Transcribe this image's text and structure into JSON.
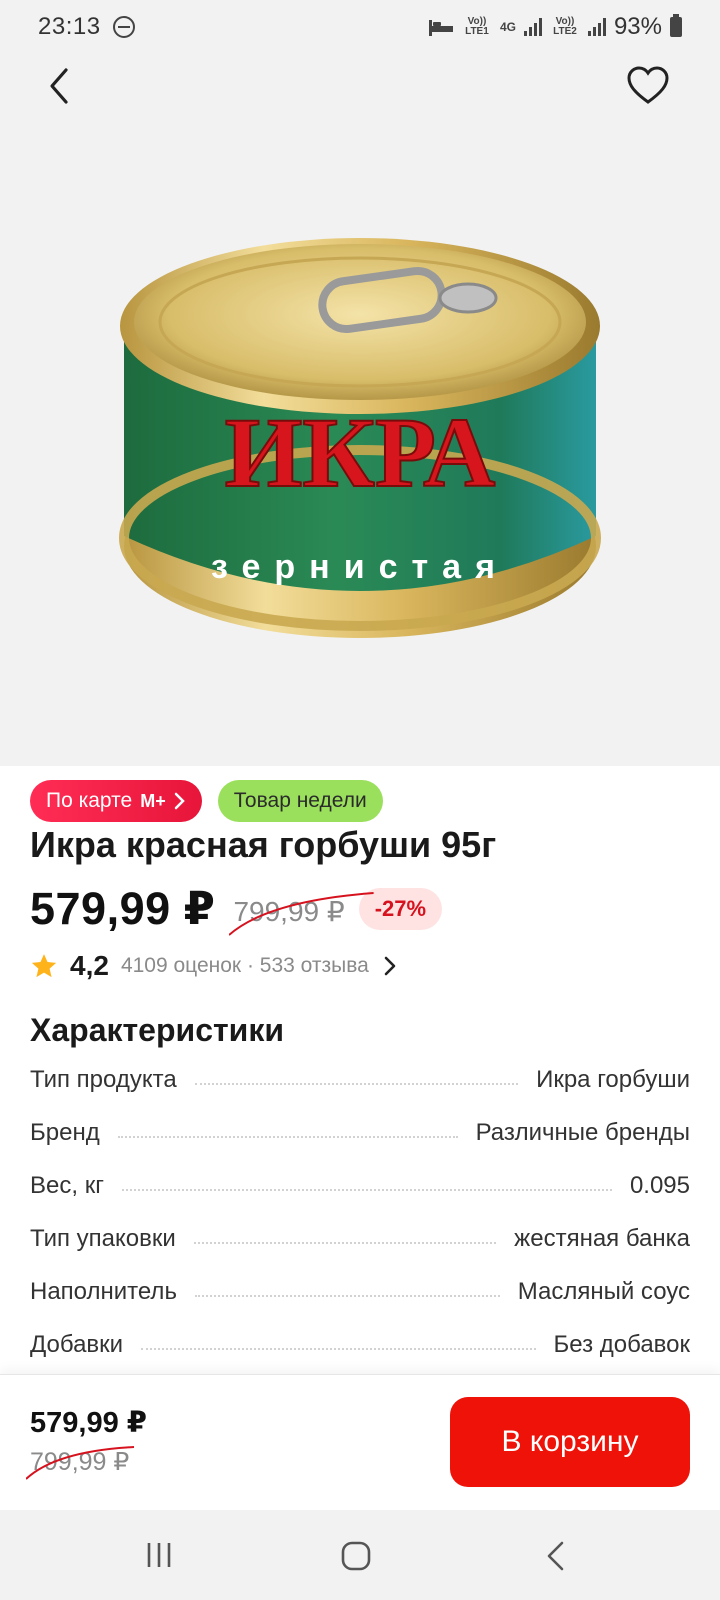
{
  "status_bar": {
    "time": "23:13",
    "lte1": "Vo)) LTE1",
    "net_4g": "4G",
    "lte2": "Vo)) LTE2",
    "battery": "93%"
  },
  "product": {
    "image_text_main": "ИКРА",
    "image_text_sub": "зернистая",
    "badge_card_label": "По карте",
    "badge_card_logo": "М+",
    "badge_week_label": "Товар недели",
    "title": "Икра красная горбуши 95г",
    "price": "579,99 ₽",
    "old_price": "799,99 ₽",
    "discount": "-27%",
    "rating": "4,2",
    "rating_meta": "4109 оценок · 533 отзыва"
  },
  "specs": {
    "title": "Характеристики",
    "rows": [
      {
        "name": "Тип продукта",
        "value": "Икра горбуши"
      },
      {
        "name": "Бренд",
        "value": "Различные бренды"
      },
      {
        "name": "Вес, кг",
        "value": "0.095"
      },
      {
        "name": "Тип упаковки",
        "value": "жестяная банка"
      },
      {
        "name": "Наполнитель",
        "value": "Масляный соус"
      },
      {
        "name": "Добавки",
        "value": "Без добавок"
      }
    ]
  },
  "buy_bar": {
    "price": "579,99 ₽",
    "old_price": "799,99 ₽",
    "button_label": "В корзину"
  },
  "colors": {
    "accent_red": "#ee1208",
    "badge_green": "#9be05d",
    "discount_bg": "#ffe3e3"
  }
}
